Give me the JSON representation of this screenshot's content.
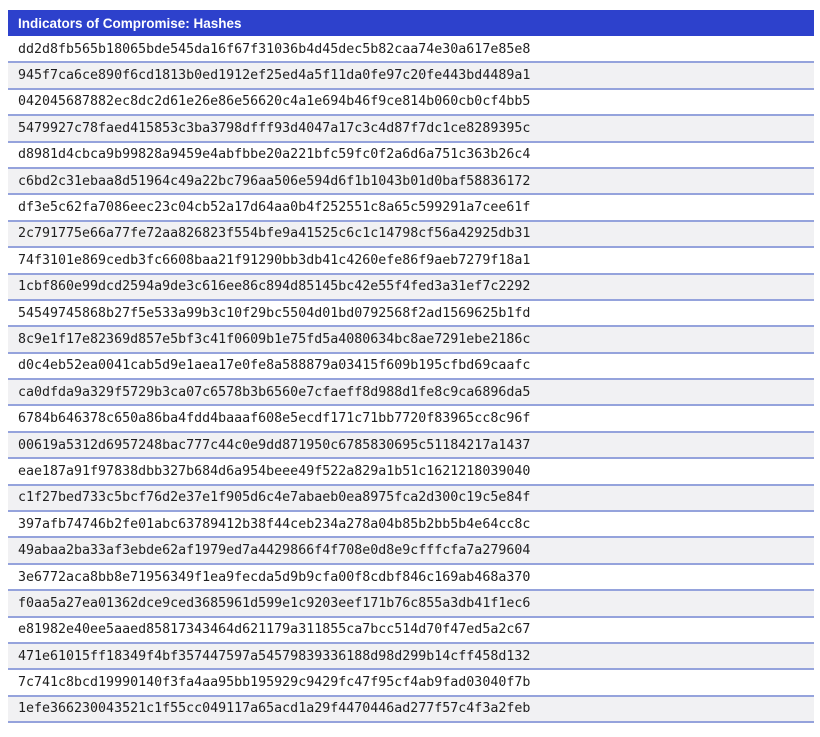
{
  "header": {
    "title": "Indicators of Compromise: Hashes"
  },
  "table": {
    "rows": [
      "dd2d8fb565b18065bde545da16f67f31036b4d45dec5b82caa74e30a617e85e8",
      "945f7ca6ce890f6cd1813b0ed1912ef25ed4a5f11da0fe97c20fe443bd4489a1",
      "042045687882ec8dc2d61e26e86e56620c4a1e694b46f9ce814b060cb0cf4bb5",
      "5479927c78faed415853c3ba3798dfff93d4047a17c3c4d87f7dc1ce8289395c",
      "d8981d4cbca9b99828a9459e4abfbbe20a221bfc59fc0f2a6d6a751c363b26c4",
      "c6bd2c31ebaa8d51964c49a22bc796aa506e594d6f1b1043b01d0baf58836172",
      "df3e5c62fa7086eec23c04cb52a17d64aa0b4f252551c8a65c599291a7cee61f",
      "2c791775e66a77fe72aa826823f554bfe9a41525c6c1c14798cf56a42925db31",
      "74f3101e869cedb3fc6608baa21f91290bb3db41c4260efe86f9aeb7279f18a1",
      "1cbf860e99dcd2594a9de3c616ee86c894d85145bc42e55f4fed3a31ef7c2292",
      "54549745868b27f5e533a99b3c10f29bc5504d01bd0792568f2ad1569625b1fd",
      "8c9e1f17e82369d857e5bf3c41f0609b1e75fd5a4080634bc8ae7291ebe2186c",
      "d0c4eb52ea0041cab5d9e1aea17e0fe8a588879a03415f609b195cfbd69caafc",
      "ca0dfda9a329f5729b3ca07c6578b3b6560e7cfaeff8d988d1fe8c9ca6896da5",
      "6784b646378c650a86ba4fdd4baaaf608e5ecdf171c71bb7720f83965cc8c96f",
      "00619a5312d6957248bac777c44c0e9dd871950c6785830695c51184217a1437",
      "eae187a91f97838dbb327b684d6a954beee49f522a829a1b51c1621218039040",
      "c1f27bed733c5bcf76d2e37e1f905d6c4e7abaeb0ea8975fca2d300c19c5e84f",
      "397afb74746b2fe01abc63789412b38f44ceb234a278a04b85b2bb5b4e64cc8c",
      "49abaa2ba33af3ebde62af1979ed7a4429866f4f708e0d8e9cfffcfa7a279604",
      "3e6772aca8bb8e71956349f1ea9fecda5d9b9cfa00f8cdbf846c169ab468a370",
      "f0aa5a27ea01362dce9ced3685961d599e1c9203eef171b76c855a3db41f1ec6",
      "e81982e40ee5aaed85817343464d621179a311855ca7bcc514d70f47ed5a2c67",
      "471e61015ff18349f4bf357447597a54579839336188d98d299b14cff458d132",
      "7c741c8bcd19990140f3fa4aa95bb195929c9429fc47f95cf4ab9fad03040f7b",
      "1efe366230043521c1f55cc049117a65acd1a29f4470446ad277f57c4f3a2feb"
    ]
  },
  "colors": {
    "header_bg": "#2d41cc",
    "header_text": "#ffffff",
    "row_bg": "#ffffff",
    "row_alt_bg": "#f1f1f3",
    "row_border": "#95a3dc",
    "hash_text": "#1f1f1f"
  }
}
